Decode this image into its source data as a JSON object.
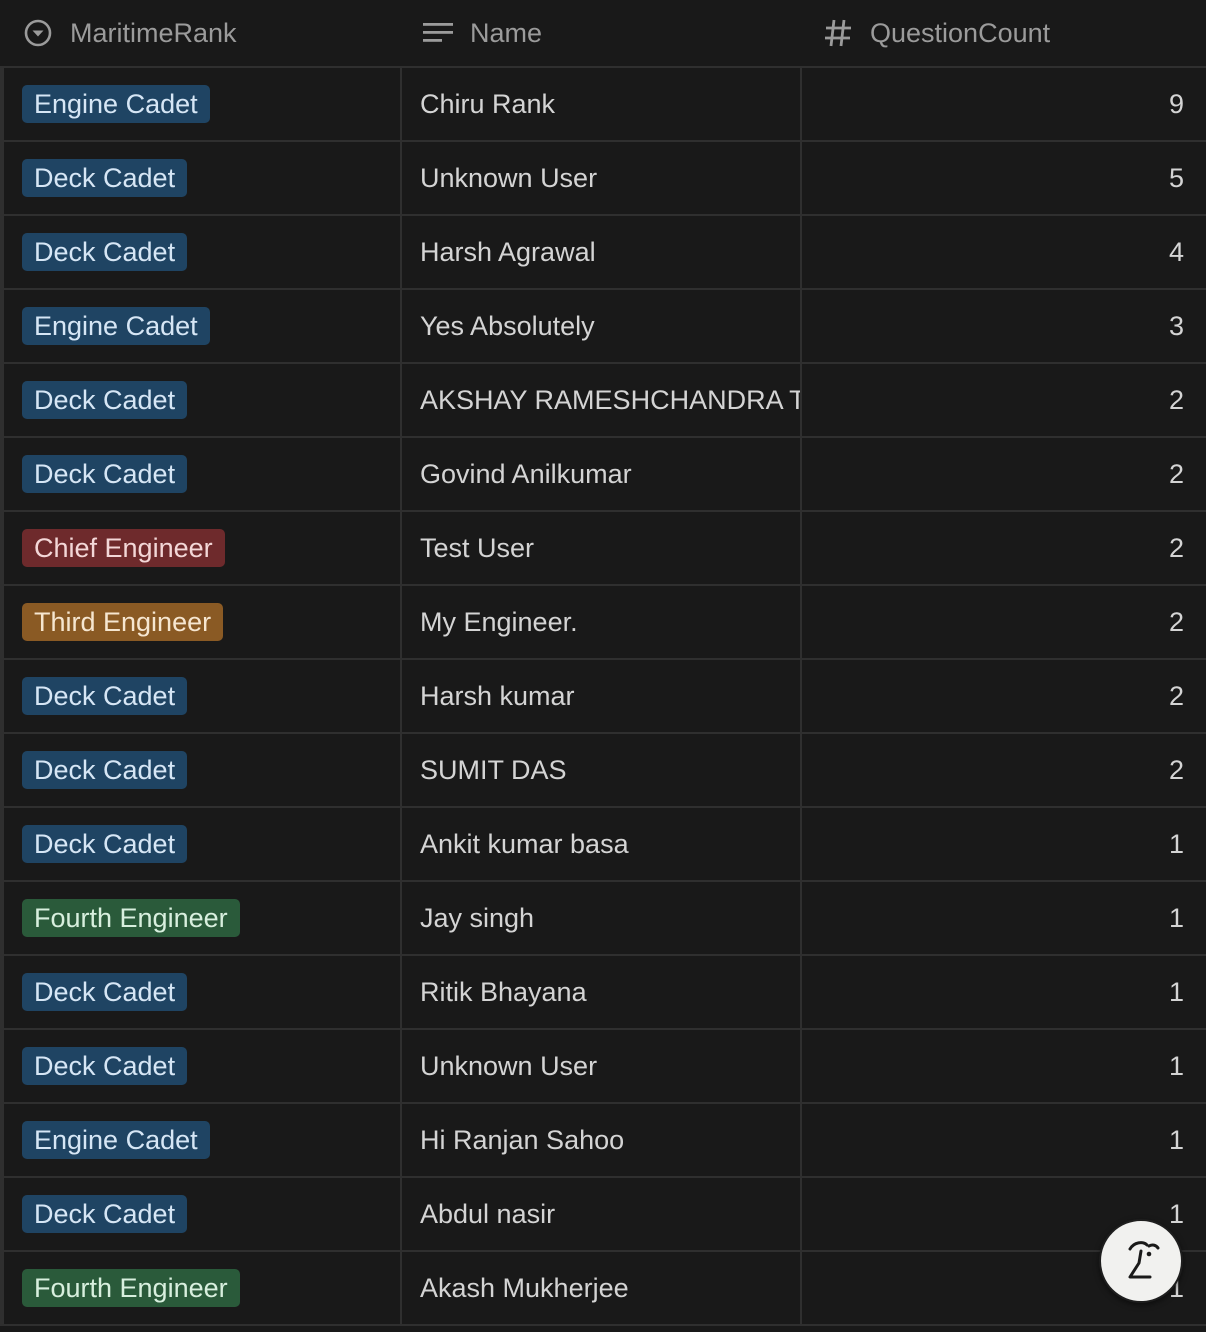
{
  "columns": {
    "rank": {
      "label": "MaritimeRank",
      "icon": "select-icon"
    },
    "name": {
      "label": "Name",
      "icon": "text-lines-icon"
    },
    "count": {
      "label": "QuestionCount",
      "icon": "hash-icon"
    }
  },
  "tag_colors": {
    "blue": "#1f4463",
    "red": "#6e2a2c",
    "orange": "#8a5a24",
    "green": "#2a5a3a"
  },
  "rows": [
    {
      "rank": "Engine Cadet",
      "color": "blue",
      "name": "Chiru Rank",
      "count": "9"
    },
    {
      "rank": "Deck Cadet",
      "color": "blue",
      "name": "Unknown User",
      "count": "5"
    },
    {
      "rank": "Deck Cadet",
      "color": "blue",
      "name": "Harsh Agrawal",
      "count": "4"
    },
    {
      "rank": "Engine Cadet",
      "color": "blue",
      "name": "Yes Absolutely",
      "count": "3"
    },
    {
      "rank": "Deck Cadet",
      "color": "blue",
      "name": "AKSHAY RAMESHCHANDRA T",
      "count": "2"
    },
    {
      "rank": "Deck Cadet",
      "color": "blue",
      "name": "Govind Anilkumar",
      "count": "2"
    },
    {
      "rank": "Chief Engineer",
      "color": "red",
      "name": "Test User",
      "count": "2"
    },
    {
      "rank": "Third Engineer",
      "color": "orange",
      "name": "My Engineer.",
      "count": "2"
    },
    {
      "rank": "Deck Cadet",
      "color": "blue",
      "name": "Harsh kumar",
      "count": "2"
    },
    {
      "rank": "Deck Cadet",
      "color": "blue",
      "name": "SUMIT DAS",
      "count": "2"
    },
    {
      "rank": "Deck Cadet",
      "color": "blue",
      "name": "Ankit kumar basa",
      "count": "1"
    },
    {
      "rank": "Fourth Engineer",
      "color": "green",
      "name": "Jay singh",
      "count": "1"
    },
    {
      "rank": "Deck Cadet",
      "color": "blue",
      "name": "Ritik Bhayana",
      "count": "1"
    },
    {
      "rank": "Deck Cadet",
      "color": "blue",
      "name": "Unknown User",
      "count": "1"
    },
    {
      "rank": "Engine Cadet",
      "color": "blue",
      "name": "Hi Ranjan Sahoo",
      "count": "1"
    },
    {
      "rank": "Deck Cadet",
      "color": "blue",
      "name": "Abdul nasir",
      "count": "1"
    },
    {
      "rank": "Fourth Engineer",
      "color": "green",
      "name": "Akash Mukherjee",
      "count": "1"
    }
  ],
  "help_button": {
    "icon": "notion-ai-face-icon"
  }
}
